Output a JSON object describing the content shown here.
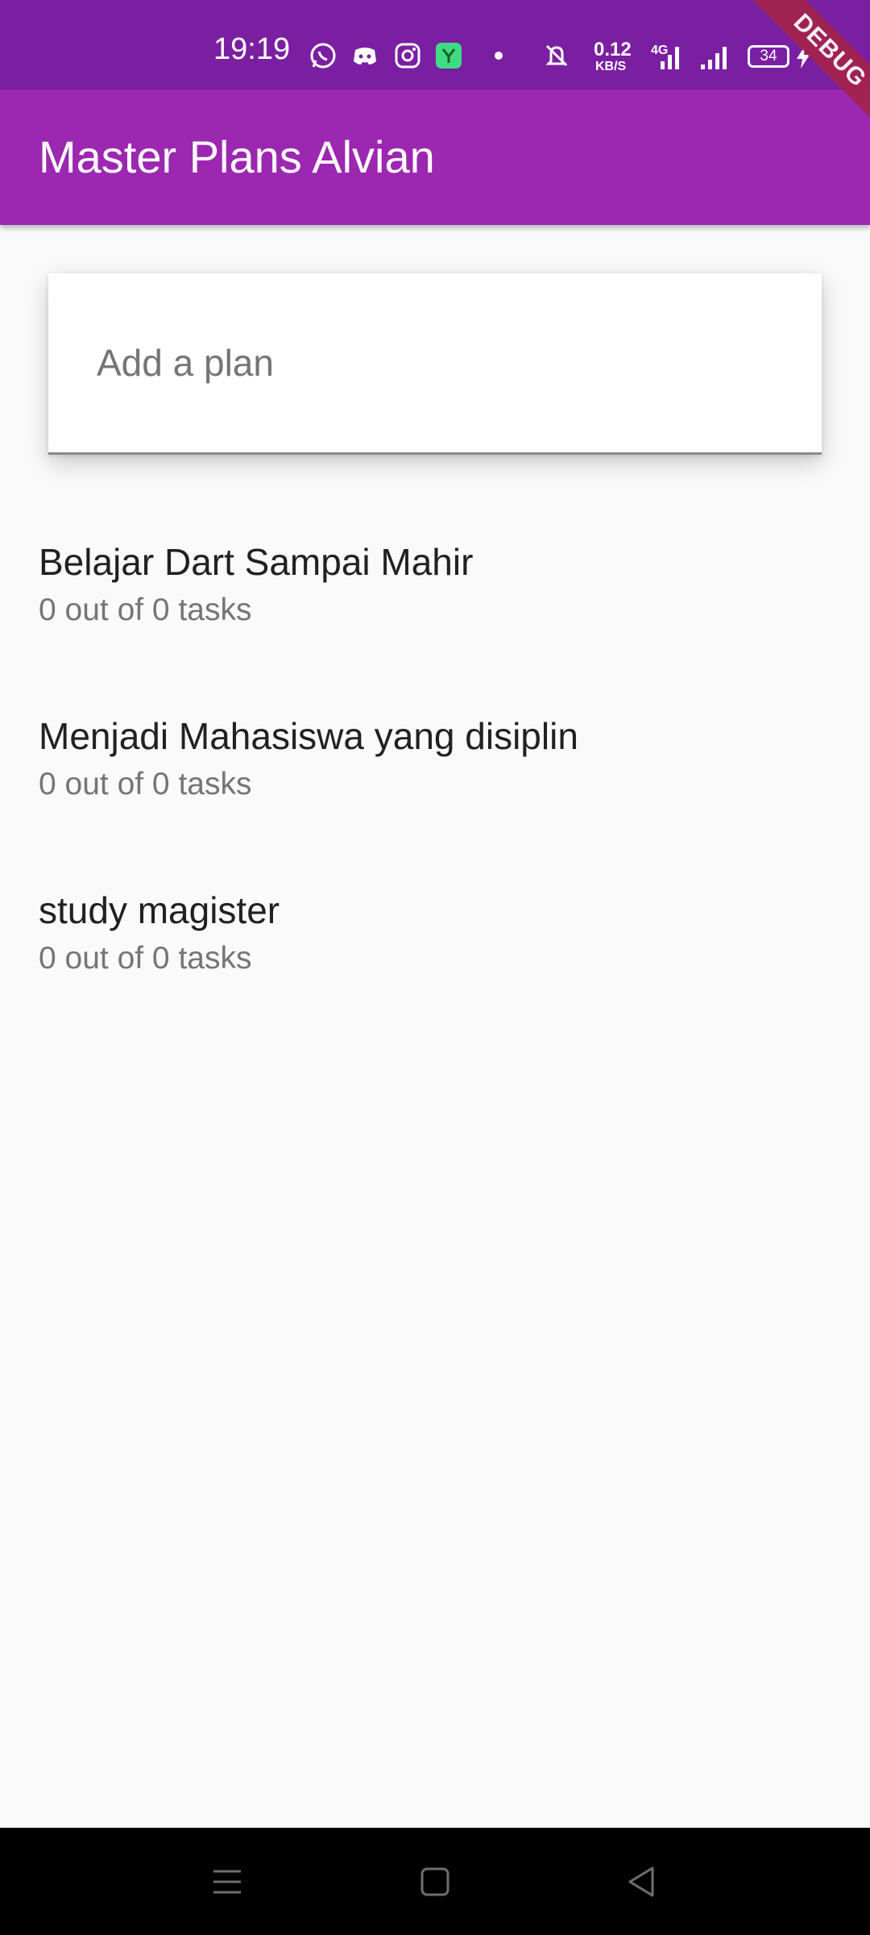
{
  "status_bar": {
    "time": "19:19",
    "net_speed": "0.12",
    "net_unit": "KB/S",
    "network_type": "4G",
    "battery_level": "34",
    "icons": [
      "whatsapp-icon",
      "discord-icon",
      "instagram-icon",
      "app-store-icon",
      "dot-icon",
      "vibrate-icon",
      "signal-icon",
      "signal-icon",
      "charging-icon"
    ]
  },
  "debug_banner": "DEBUG",
  "app_bar": {
    "title": "Master Plans Alvian",
    "color": "#9c27b0"
  },
  "add_plan": {
    "placeholder": "Add a plan",
    "value": ""
  },
  "plans": [
    {
      "title": "Belajar Dart Sampai Mahir",
      "subtitle": "0 out of 0 tasks"
    },
    {
      "title": "Menjadi Mahasiswa yang disiplin",
      "subtitle": "0 out of 0 tasks"
    },
    {
      "title": "study magister",
      "subtitle": "0 out of 0 tasks"
    }
  ],
  "nav_bar": {
    "buttons": [
      "menu-icon",
      "home-icon",
      "back-icon"
    ]
  },
  "colors": {
    "status_bar": "#7b1fa2",
    "app_bar": "#9c27b0",
    "background": "#fafafa",
    "debug_banner": "#a3234a"
  }
}
